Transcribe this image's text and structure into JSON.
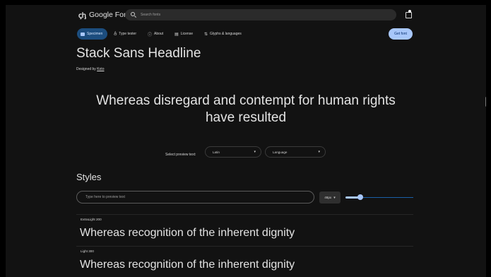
{
  "header": {
    "logo_text": "Google Fonts",
    "logo_mark": "ꞔꞕ",
    "search_placeholder": "Search fonts",
    "cart_icon": "bag-icon"
  },
  "nav": {
    "tabs": [
      {
        "label": "Specimen",
        "icon": "specimen-icon",
        "active": true
      },
      {
        "label": "Type tester",
        "icon": "type-tester-icon",
        "active": false
      },
      {
        "label": "About",
        "icon": "info-icon",
        "active": false
      },
      {
        "label": "License",
        "icon": "license-icon",
        "active": false
      },
      {
        "label": "Glyphs & languages",
        "icon": "glyphs-icon",
        "active": false
      }
    ],
    "get_font_label": "Get font"
  },
  "family": {
    "title": "Stack Sans Headline",
    "designed_by": "Designed by",
    "designer": "Koto"
  },
  "specimen": {
    "line1": "Whereas disregard and contempt for human rights",
    "line2": "have resulted"
  },
  "preview_controls": {
    "label": "Select preview text:",
    "script_value": "Latin",
    "language_placeholder": "Language"
  },
  "styles": {
    "heading": "Styles",
    "input_placeholder": "Type here to preview text",
    "size_value": "48px",
    "slider_fraction": 0.22,
    "items": [
      {
        "label": "ExtraLight 200",
        "preview": "Whereas recognition of the inherent dignity"
      },
      {
        "label": "Light 300",
        "preview": "Whereas recognition of the inherent dignity"
      }
    ]
  },
  "colors": {
    "background": "#121212",
    "accent": "#a8c7fa",
    "active_tab": "#1c4d7e"
  }
}
